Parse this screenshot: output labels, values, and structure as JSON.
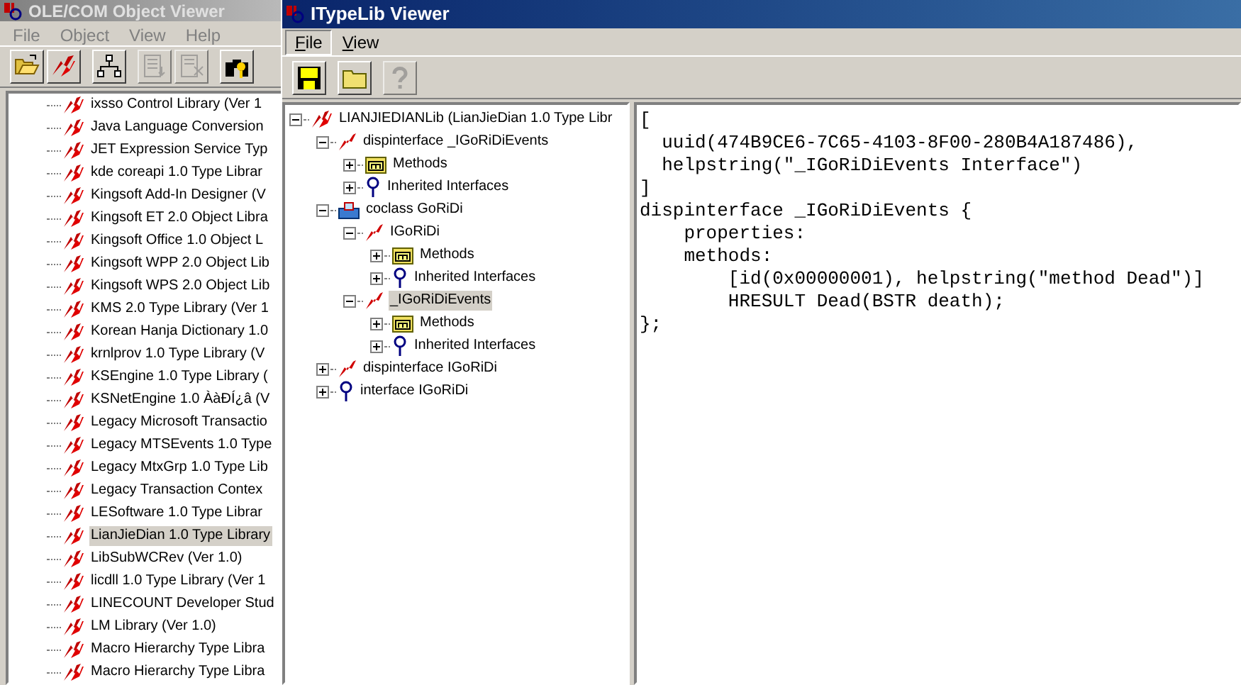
{
  "back_window": {
    "title": "OLE/COM Object Viewer",
    "active": false,
    "menu": [
      {
        "label": "File"
      },
      {
        "label": "Object"
      },
      {
        "label": "View"
      },
      {
        "label": "Help"
      }
    ],
    "toolbar": [
      {
        "kind": "open",
        "disabled": false
      },
      {
        "kind": "typelib",
        "disabled": false
      },
      {
        "kind": "hierarchy",
        "disabled": false
      },
      {
        "kind": "doc",
        "disabled": true
      },
      {
        "kind": "doc-x",
        "disabled": true
      },
      {
        "kind": "binoculars",
        "disabled": false
      }
    ],
    "tree": [
      {
        "label": "ixsso Control Library (Ver 1",
        "selected": false
      },
      {
        "label": "Java Language Conversion",
        "selected": false
      },
      {
        "label": "JET Expression Service Typ",
        "selected": false
      },
      {
        "label": "kde coreapi 1.0 Type Librar",
        "selected": false
      },
      {
        "label": "Kingsoft Add-In Designer (V",
        "selected": false
      },
      {
        "label": "Kingsoft ET 2.0 Object Libra",
        "selected": false
      },
      {
        "label": "Kingsoft Office 1.0 Object L",
        "selected": false
      },
      {
        "label": "Kingsoft WPP 2.0 Object Lib",
        "selected": false
      },
      {
        "label": "Kingsoft WPS 2.0 Object Lib",
        "selected": false
      },
      {
        "label": "KMS 2.0 Type Library (Ver 1",
        "selected": false
      },
      {
        "label": "Korean Hanja Dictionary 1.0",
        "selected": false
      },
      {
        "label": "krnlprov 1.0 Type Library (V",
        "selected": false
      },
      {
        "label": "KSEngine 1.0 Type Library (",
        "selected": false
      },
      {
        "label": "KSNetEngine 1.0 ÀàÐÍ¿â (V",
        "selected": false
      },
      {
        "label": "Legacy Microsoft Transactio",
        "selected": false
      },
      {
        "label": "Legacy MTSEvents 1.0 Type",
        "selected": false
      },
      {
        "label": "Legacy MtxGrp 1.0 Type Lib",
        "selected": false
      },
      {
        "label": "Legacy Transaction Contex",
        "selected": false
      },
      {
        "label": "LESoftware 1.0 Type Librar",
        "selected": false
      },
      {
        "label": "LianJieDian 1.0 Type Library",
        "selected": true
      },
      {
        "label": "LibSubWCRev (Ver 1.0)",
        "selected": false
      },
      {
        "label": "licdll 1.0 Type Library (Ver 1",
        "selected": false
      },
      {
        "label": "LINECOUNT Developer Stud",
        "selected": false
      },
      {
        "label": "LM Library (Ver 1.0)",
        "selected": false
      },
      {
        "label": "Macro Hierarchy Type Libra",
        "selected": false
      },
      {
        "label": "Macro Hierarchy Type Libra",
        "selected": false
      }
    ]
  },
  "front_window": {
    "title": "ITypeLib Viewer",
    "active": true,
    "menu": [
      {
        "label": "File",
        "selected": true
      },
      {
        "label": "View",
        "selected": false
      }
    ],
    "toolbar": [
      {
        "kind": "save",
        "disabled": false
      },
      {
        "kind": "folder",
        "disabled": false
      },
      {
        "kind": "help",
        "disabled": true
      }
    ],
    "tree": [
      {
        "label": "LIANJIEDIANLib (LianJieDian 1.0 Type Libr",
        "kind": "typelib",
        "expanded": true,
        "selected": false,
        "children": [
          {
            "label": "dispinterface _IGoRiDiEvents",
            "kind": "dispinterface",
            "expanded": true,
            "selected": false,
            "children": [
              {
                "label": "Methods",
                "kind": "methods",
                "expanded": false,
                "selected": false
              },
              {
                "label": "Inherited Interfaces",
                "kind": "interface",
                "expanded": false,
                "selected": false
              }
            ]
          },
          {
            "label": "coclass GoRiDi",
            "kind": "coclass",
            "expanded": true,
            "selected": false,
            "children": [
              {
                "label": "IGoRiDi",
                "kind": "dispinterface",
                "expanded": true,
                "selected": false,
                "children": [
                  {
                    "label": "Methods",
                    "kind": "methods",
                    "expanded": false,
                    "selected": false
                  },
                  {
                    "label": "Inherited Interfaces",
                    "kind": "interface",
                    "expanded": false,
                    "selected": false
                  }
                ]
              },
              {
                "label": "_IGoRiDiEvents",
                "kind": "dispinterface",
                "expanded": true,
                "selected": true,
                "children": [
                  {
                    "label": "Methods",
                    "kind": "methods",
                    "expanded": false,
                    "selected": false
                  },
                  {
                    "label": "Inherited Interfaces",
                    "kind": "interface",
                    "expanded": false,
                    "selected": false
                  }
                ]
              }
            ]
          },
          {
            "label": "dispinterface IGoRiDi",
            "kind": "dispinterface",
            "expanded": false,
            "selected": false
          },
          {
            "label": "interface IGoRiDi",
            "kind": "interface",
            "expanded": false,
            "selected": false
          }
        ]
      }
    ],
    "code": [
      "[",
      "  uuid(474B9CE6-7C65-4103-8F00-280B4A187486),",
      "  helpstring(\"_IGoRiDiEvents Interface\")",
      "]",
      "dispinterface _IGoRiDiEvents {",
      "    properties:",
      "    methods:",
      "        [id(0x00000001), helpstring(\"method Dead\")]",
      "        HRESULT Dead(BSTR death);",
      "};"
    ]
  }
}
